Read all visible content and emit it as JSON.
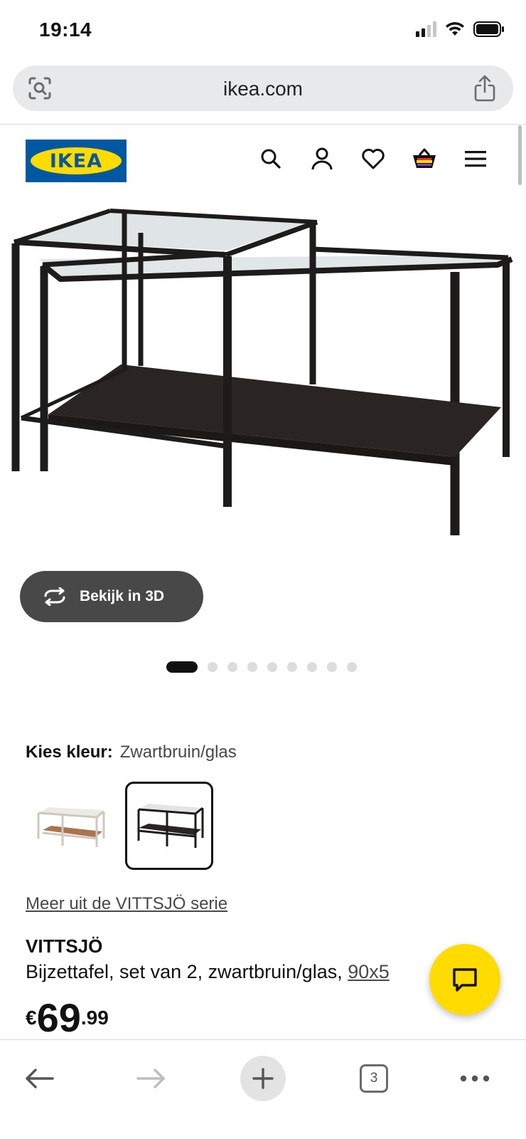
{
  "status_bar": {
    "time": "19:14"
  },
  "browser": {
    "url": "ikea.com",
    "open_tabs": "3"
  },
  "brand": {
    "logo_text": "IKEA",
    "blue": "#0058a3",
    "yellow": "#ffdb00"
  },
  "header": {
    "icons": [
      "search-icon",
      "account-icon",
      "heart-icon",
      "cart-icon",
      "menu-icon"
    ]
  },
  "product": {
    "view_3d_label": "Bekijk in 3D",
    "carousel": {
      "total": 9,
      "active": 1
    },
    "color_label": "Kies kleur:",
    "color_value": "Zwartbruin/glas",
    "swatches": [
      "Wit/glas",
      "Zwartbruin/glas"
    ],
    "series_link": "Meer uit de VITTSJÖ serie",
    "name": "VITTSJÖ",
    "description": "Bijzettafel, set van 2, zwartbruin/glas, ",
    "size_link": "90x5",
    "price": {
      "currency": "€",
      "integer": "69",
      "decimal": ".99"
    }
  }
}
